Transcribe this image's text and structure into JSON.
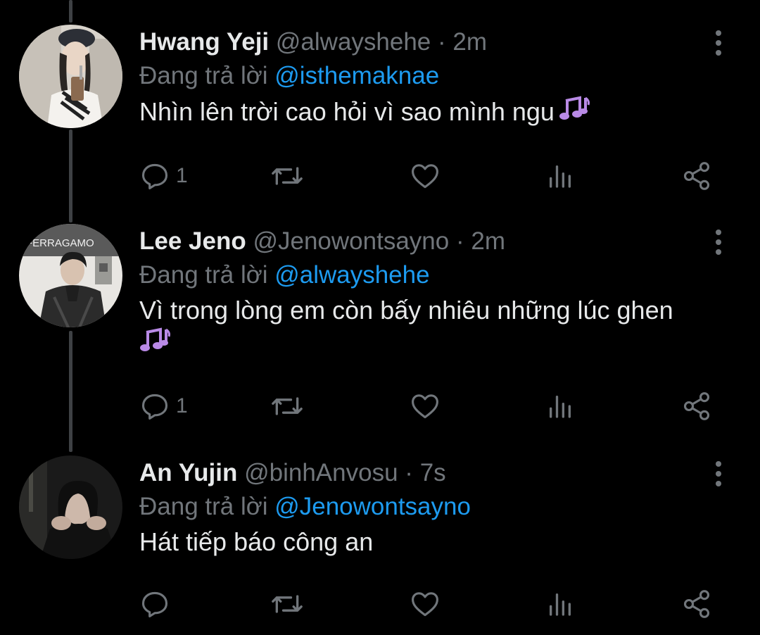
{
  "reply_prefix": "Đang trả lời",
  "colors": {
    "background": "#000000",
    "text": "#e7e9ea",
    "muted": "#71767b",
    "mention": "#1d9bf0",
    "thread_line": "#3e4144"
  },
  "icons": {
    "reply": "speech-bubble-icon",
    "retweet": "retweet-icon",
    "like": "heart-icon",
    "views": "bar-chart-icon",
    "share": "share-icon",
    "more": "vertical-dots-icon",
    "emoji": "musical-notes-emoji"
  },
  "tweets": [
    {
      "name": "Hwang Yeji",
      "handle": "@alwayshehe",
      "separator": "·",
      "time": "2m",
      "reply_to": "@isthemaknae",
      "text": "Nhìn lên trời cao hỏi vì sao mình ngu",
      "has_emoji": true,
      "reply_count": "1"
    },
    {
      "name": "Lee Jeno",
      "handle": "@Jenowontsayno",
      "separator": "·",
      "time": "2m",
      "reply_to": "@alwayshehe",
      "text": "Vì trong lòng em còn bấy nhiêu những lúc ghen",
      "has_emoji": true,
      "reply_count": "1",
      "avatar_text": "FERRAGAMO"
    },
    {
      "name": "An Yujin",
      "handle": "@binhAnvosu",
      "separator": "·",
      "time": "7s",
      "reply_to": "@Jenowontsayno",
      "text": "Hát tiếp báo công an",
      "has_emoji": false,
      "reply_count": ""
    }
  ]
}
